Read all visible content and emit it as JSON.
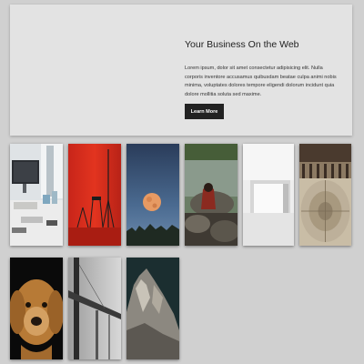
{
  "hero": {
    "title": "Your Business On the Web",
    "text": "Lorem ipsum, dolor sit amet consectetur adipisicing elit. Nulla corporis inventore accusamus quibusdam beatae culpa animi nobis minima, voluptates dolores tempore eligendi dolorum incidunt quia dolore mollitia soluta sed maxime.",
    "button_label": "Learn More"
  },
  "gallery": {
    "photos": [
      {
        "subject": "desk-with-monitor-photo"
      },
      {
        "subject": "red-wall-with-ladders-photo"
      },
      {
        "subject": "moon-over-trees-photo"
      },
      {
        "subject": "person-by-river-rocks-photo"
      },
      {
        "subject": "white-room-photo"
      },
      {
        "subject": "ornate-courtyard-photo"
      },
      {
        "subject": "golden-dog-photo"
      },
      {
        "subject": "foggy-bridge-photo"
      },
      {
        "subject": "rocky-mountain-photo"
      }
    ]
  }
}
